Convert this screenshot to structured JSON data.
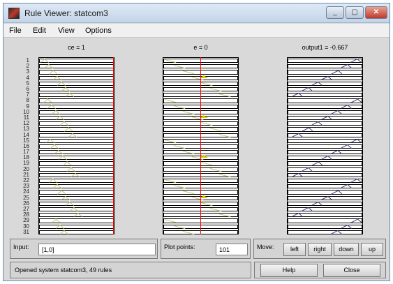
{
  "window": {
    "title": "Rule Viewer: statcom3",
    "minimize": "_",
    "maximize": "▢",
    "close": "✕"
  },
  "menu": [
    "File",
    "Edit",
    "View",
    "Options"
  ],
  "columns": [
    {
      "title": "ce = 1"
    },
    {
      "title": "e = 0"
    },
    {
      "title": "output1 = -0.667"
    }
  ],
  "rules": [
    "1",
    "2",
    "3",
    "4",
    "5",
    "6",
    "7",
    "8",
    "9",
    "10",
    "11",
    "12",
    "13",
    "14",
    "15",
    "16",
    "17",
    "18",
    "19",
    "20",
    "21",
    "22",
    "23",
    "24",
    "25",
    "26",
    "27",
    "28",
    "29",
    "30",
    "31"
  ],
  "controls": {
    "input_label": "Input:",
    "input_value": "[1,0]",
    "plot_points_label": "Plot points:",
    "plot_points_value": "101",
    "move_label": "Move:",
    "move_buttons": [
      "left",
      "right",
      "down",
      "up"
    ]
  },
  "status": "Opened system statcom3, 49 rules",
  "buttons": {
    "help": "Help",
    "close": "Close"
  },
  "colors": {
    "mf_input": "#c8c878",
    "mf_output": "#3a3a7a",
    "active_fill": "#e0c200",
    "indicator": "#ff0000"
  }
}
